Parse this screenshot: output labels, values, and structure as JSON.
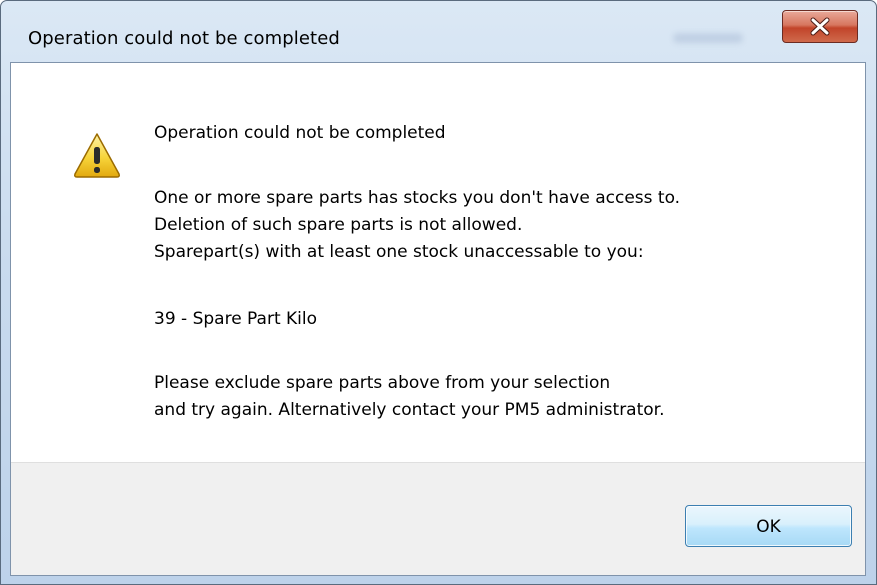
{
  "window": {
    "title": "Operation could not be completed"
  },
  "titlebar": {
    "close_icon": "close-x-icon"
  },
  "message": {
    "icon": "warning-icon",
    "heading": "Operation could not be completed",
    "line1": "One or more spare parts has stocks you don't have access to.",
    "line2": "Deletion of such spare parts is not allowed.",
    "line3": "Sparepart(s) with at least one stock unaccessable to you:",
    "item": "39 - Spare Part Kilo",
    "line4": "Please exclude spare parts above from your selection",
    "line5": "and try again. Alternatively contact your PM5 administrator."
  },
  "buttons": {
    "ok_label": "OK"
  },
  "colors": {
    "close_button": "#c7503a",
    "ok_button_border": "#3c7fb1",
    "footer_background": "#f0f0f0"
  }
}
